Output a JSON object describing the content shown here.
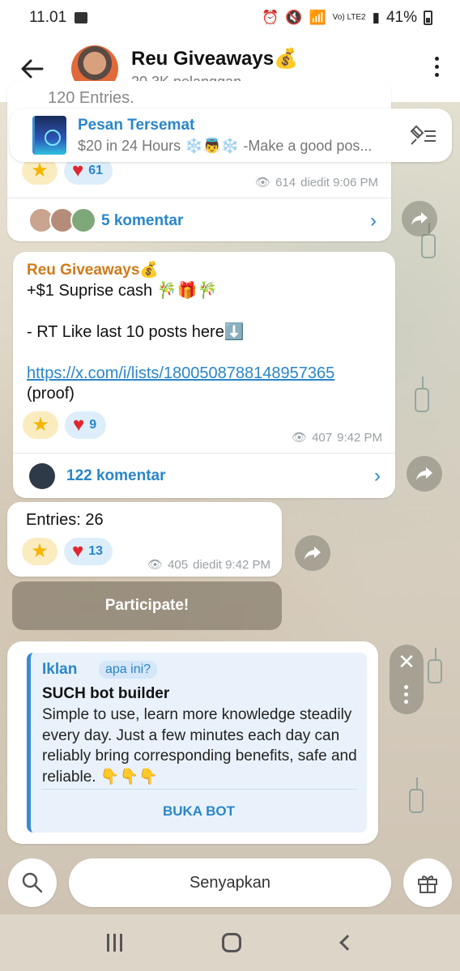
{
  "status_bar": {
    "time": "11.01",
    "network": "Vo) LTE2",
    "battery": "41%"
  },
  "header": {
    "title": "Reu Giveaways💰",
    "subtitle": "20.3K pelanggan"
  },
  "pinned": {
    "title": "Pesan Tersemat",
    "preview": "$20 in 24 Hours ❄️👼❄️ -Make a good pos..."
  },
  "top_post": {
    "partial_text": "120 Entries.",
    "heart_count": "61",
    "views": "614",
    "edited_time": "diedit 9:06 PM",
    "comments_label": "5 komentar"
  },
  "post_2": {
    "sender": "Reu Giveaways💰",
    "line1": "+$1 Suprise cash 🎋🎁🎋",
    "line2": "- RT Like last 10 posts here⬇️",
    "link": "https://x.com/i/lists/1800508788148957365",
    "line3": "(proof)",
    "heart_count": "9",
    "views": "407",
    "time": "9:42 PM",
    "comments_label": "122 komentar"
  },
  "post_3": {
    "text": "Entries: 26",
    "heart_count": "13",
    "views": "405",
    "edited_time": "diedit 9:42 PM"
  },
  "participate_button": "Participate!",
  "ad": {
    "label": "Iklan",
    "what_label": "apa ini?",
    "title": "SUCH bot builder",
    "body": "Simple to use, learn more knowledge steadily every day. Just a few minutes each day can reliably bring corresponding benefits, safe and reliable. 👇👇👇",
    "button": "BUKA BOT"
  },
  "bottom_bar": {
    "mute_label": "Senyapkan"
  },
  "icons": {
    "back": "back-arrow-icon",
    "menu": "more-vertical-icon",
    "pin": "pinned-list-icon",
    "share": "share-arrow-icon",
    "search": "search-icon",
    "gift": "gift-icon"
  },
  "colors": {
    "accent": "#2a86c9",
    "sender": "#d17a1a",
    "heart": "#e0262f",
    "star": "#f4b400"
  }
}
